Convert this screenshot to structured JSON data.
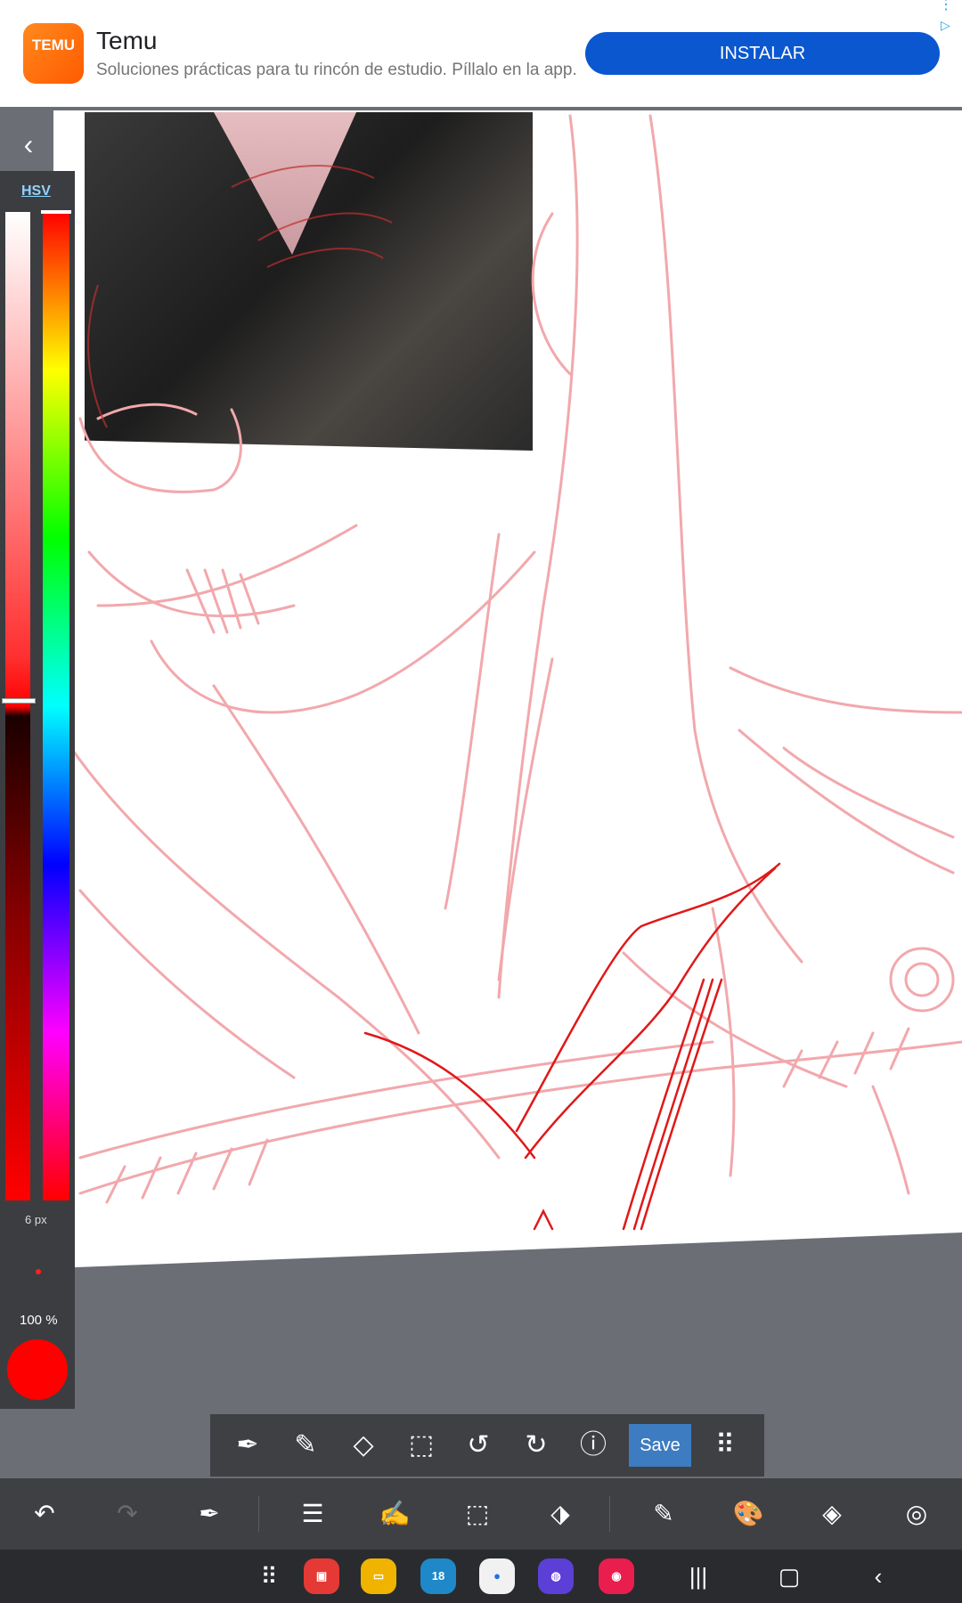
{
  "ad": {
    "logo_text": "TEMU",
    "title": "Temu",
    "description": "Soluciones prácticas para tu rincón de estudio. Píllalo en la app.",
    "cta_label": "INSTALAR"
  },
  "color_panel": {
    "mode_label": "HSV",
    "brush_size": "6 px",
    "opacity": "100 %",
    "current_color": "#ff0000"
  },
  "float_toolbar": {
    "save_label": "Save",
    "icons": [
      "eyedropper-icon",
      "pen-icon",
      "eraser-icon",
      "deselect-icon",
      "rotate-left-icon",
      "rotate-right-icon",
      "help-icon",
      "grid-icon"
    ]
  },
  "bottom_toolbar": {
    "icons": [
      "undo-icon",
      "redo-icon",
      "eyedropper-icon",
      "menu-icon",
      "edit-icon",
      "selection-icon",
      "transform-icon",
      "brush-icon",
      "palette-icon",
      "layers-icon",
      "settings-icon"
    ]
  },
  "nav_bar": {
    "calendar_day": "18"
  },
  "colors": {
    "accent": "#0b57d0",
    "save": "#3d7cc0",
    "toolbar_bg": "#3f4044",
    "sketch_line": "#f2a8ac",
    "ink_line": "#e01818"
  }
}
